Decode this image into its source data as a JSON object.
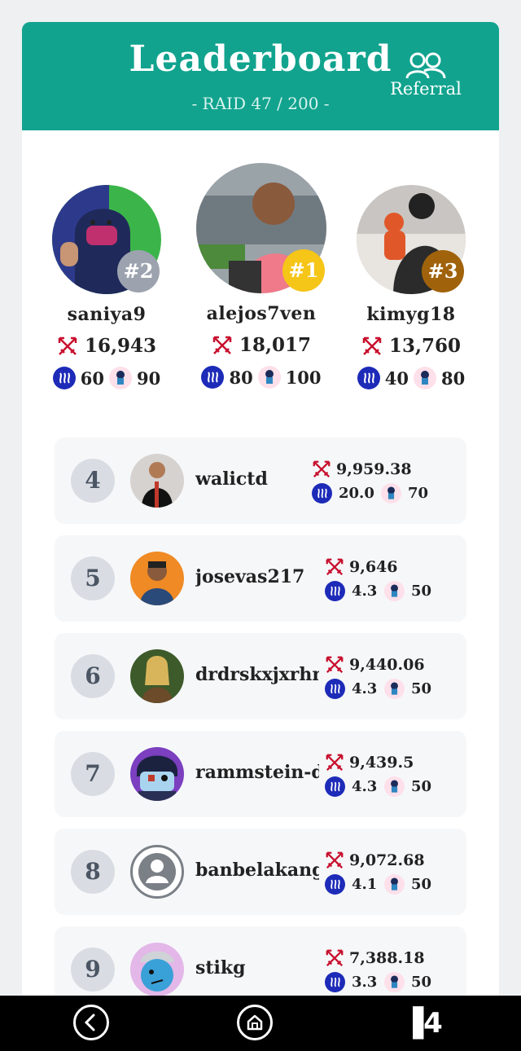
{
  "header": {
    "title": "Leaderboard",
    "subtitle": "- RAID 47 / 200 -",
    "referral_label": "Referral",
    "color": "#11a38e"
  },
  "podium": [
    {
      "rank": "#2",
      "name": "saniya9",
      "score": "16,943",
      "steem": "60",
      "token": "90",
      "badge_color": "#9ca3af"
    },
    {
      "rank": "#1",
      "name": "alejos7ven",
      "score": "18,017",
      "steem": "80",
      "token": "100",
      "badge_color": "#f5c518"
    },
    {
      "rank": "#3",
      "name": "kimyg18",
      "score": "13,760",
      "steem": "40",
      "token": "80",
      "badge_color": "#a0620b"
    }
  ],
  "rows": [
    {
      "rank": "4",
      "name": "walictd",
      "score": "9,959.38",
      "steem": "20.0",
      "token": "70"
    },
    {
      "rank": "5",
      "name": "josevas217",
      "score": "9,646",
      "steem": "4.3",
      "token": "50"
    },
    {
      "rank": "6",
      "name": "drdrskxjxrhn",
      "score": "9,440.06",
      "steem": "4.3",
      "token": "50"
    },
    {
      "rank": "7",
      "name": "rammstein-dj",
      "score": "9,439.5",
      "steem": "4.3",
      "token": "50"
    },
    {
      "rank": "8",
      "name": "banbelakang",
      "score": "9,072.68",
      "steem": "4.1",
      "token": "50"
    },
    {
      "rank": "9",
      "name": "stikg",
      "score": "7,388.18",
      "steem": "3.3",
      "token": "50"
    }
  ],
  "nav": {
    "logo_text": "▐4",
    "icons": [
      "back-icon",
      "home-icon",
      "app-logo-icon"
    ]
  },
  "colors": {
    "steem_blue": "#1d2bb8",
    "sword_red": "#c8102e",
    "rank_circle": "#d9dde3"
  }
}
